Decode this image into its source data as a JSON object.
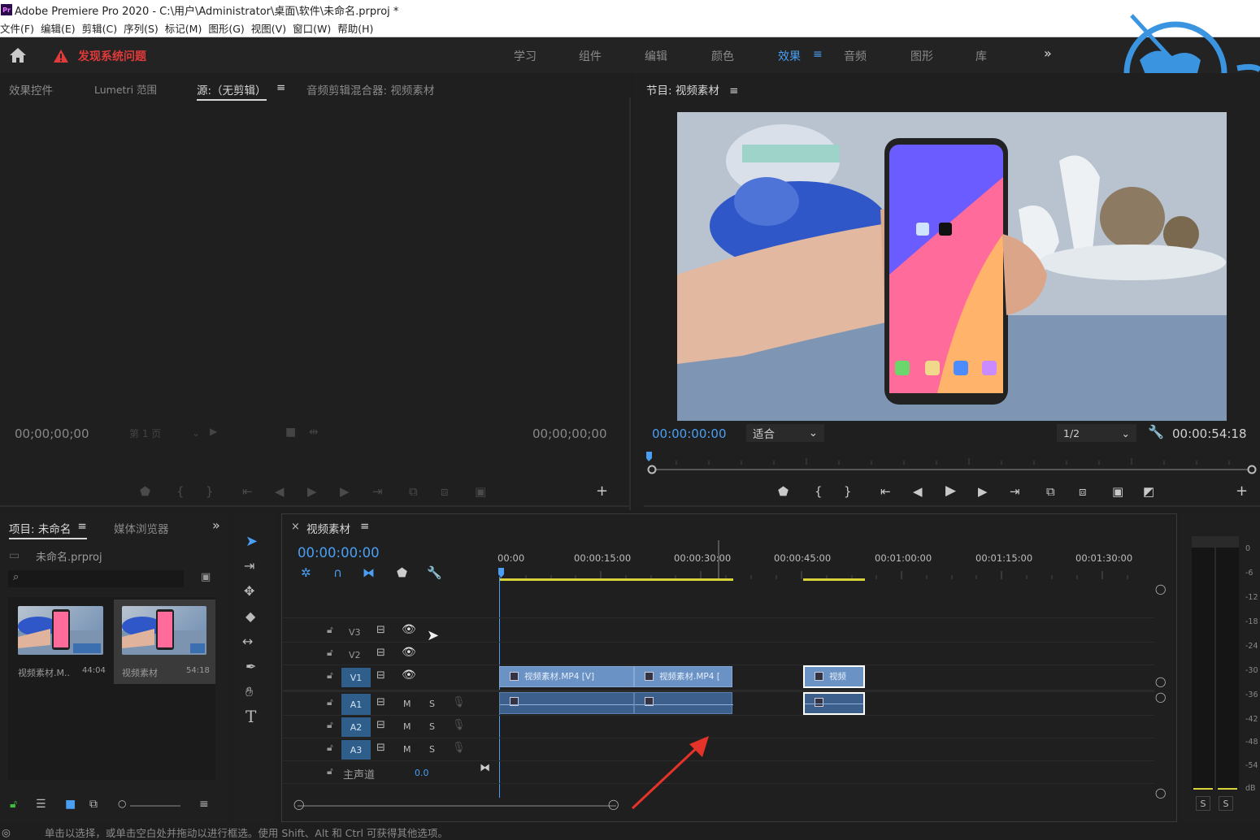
{
  "window": {
    "title": "Adobe Premiere Pro 2020 - C:\\用户\\Administrator\\桌面\\软件\\未命名.prproj *",
    "logo": "Pr"
  },
  "menu": [
    "文件(F)",
    "编辑(E)",
    "剪辑(C)",
    "序列(S)",
    "标记(M)",
    "图形(G)",
    "视图(V)",
    "窗口(W)",
    "帮助(H)"
  ],
  "header": {
    "warning": "发现系统问题",
    "workspaces": [
      "学习",
      "组件",
      "编辑",
      "颜色",
      "效果",
      "音频",
      "图形",
      "库"
    ],
    "active_workspace": "效果",
    "overflow": "»"
  },
  "source_panel": {
    "tabs": [
      "效果控件",
      "Lumetri 范围",
      "源:（无剪辑）",
      "音频剪辑混合器: 视频素材"
    ],
    "active_tab": "源:（无剪辑）",
    "timecode_in": "00;00;00;00",
    "timecode_out": "00;00;00;00",
    "page_select": "第 1 页"
  },
  "program_panel": {
    "title": "节目: 视频素材",
    "timecode": "00:00:00:00",
    "fit": "适合",
    "resolution": "1/2",
    "duration": "00:00:54:18"
  },
  "project_panel": {
    "title": "项目: 未命名",
    "media_browser": "媒体浏览器",
    "file": "未命名.prproj",
    "items": [
      {
        "name": "视频素材.M..",
        "duration": "44:04"
      },
      {
        "name": "视频素材",
        "duration": "54:18"
      }
    ]
  },
  "timeline": {
    "sequence": "视频素材",
    "timecode": "00:00:00:00",
    "ruler": [
      "00:00",
      "00:00:15:00",
      "00:00:30:00",
      "00:00:45:00",
      "00:01:00:00",
      "00:01:15:00",
      "00:01:30:00"
    ],
    "video_tracks": [
      "V3",
      "V2",
      "V1"
    ],
    "audio_tracks": [
      "A1",
      "A2",
      "A3"
    ],
    "master": "主声道",
    "master_value": "0.0",
    "mute": "M",
    "solo": "S",
    "clips": [
      "视频素材.MP4 [V]",
      "视频素材.MP4 [",
      "视频"
    ]
  },
  "meter": {
    "labels": [
      "0",
      "-6",
      "-12",
      "-18",
      "-24",
      "-30",
      "-36",
      "-42",
      "-48",
      "-54",
      "dB"
    ],
    "solo": [
      "S",
      "S"
    ]
  },
  "status": "单击以选择，或单击空白处并拖动以进行框选。使用 Shift、Alt 和 Ctrl 可获得其他选项。",
  "colors": {
    "accent": "#4a9ff5",
    "warning": "#e03a3a",
    "clip_video": "#6b92c4",
    "clip_audio": "#3c5f8c",
    "bg": "#1e1e1e"
  }
}
